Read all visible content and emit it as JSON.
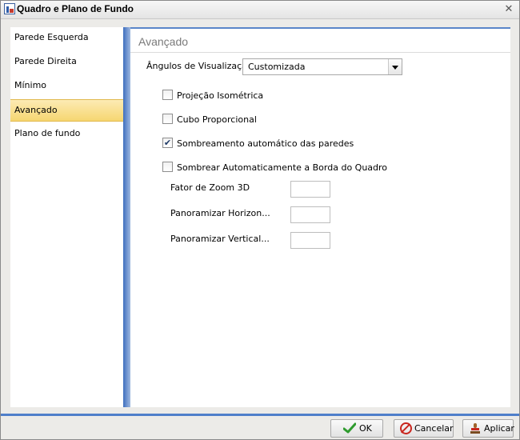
{
  "window": {
    "title": "Quadro e Plano de Fundo",
    "close_glyph": "✕"
  },
  "sidebar": {
    "items": [
      {
        "label": "Parede Esquerda",
        "active": false
      },
      {
        "label": "Parede Direita",
        "active": false
      },
      {
        "label": "Mínimo",
        "active": false
      },
      {
        "label": "Avançado",
        "active": true
      },
      {
        "label": "Plano de fundo",
        "active": false
      }
    ]
  },
  "panel": {
    "title": "Avançado",
    "view_angles": {
      "label": "Ângulos de Visualização",
      "selected": "Customizada"
    },
    "checkboxes": [
      {
        "label": "Projeção Isométrica",
        "checked": false
      },
      {
        "label": "Cubo Proporcional",
        "checked": false
      },
      {
        "label": "Sombreamento automático das paredes",
        "checked": true
      },
      {
        "label": "Sombrear Automaticamente a Borda do Quadro",
        "checked": false
      }
    ],
    "fields": [
      {
        "label": "Fator de Zoom 3D",
        "value": ""
      },
      {
        "label": "Panoramizar Horizon...",
        "value": ""
      },
      {
        "label": "Panoramizar Vertical...",
        "value": ""
      }
    ]
  },
  "footer": {
    "ok_label": "OK",
    "cancel_label": "Cancelar",
    "apply_label": "Aplicar"
  },
  "colors": {
    "accent": "#4f7fca",
    "active_item": "#f6d671",
    "ok_check": "#2e9b2e",
    "cancel_red": "#c9261e"
  },
  "icons": {
    "app": "chart-app-icon",
    "close": "close-icon",
    "ok": "checkmark-icon",
    "cancel": "no-entry-icon",
    "apply": "stamp-icon",
    "dropdown": "chevron-down-icon"
  }
}
